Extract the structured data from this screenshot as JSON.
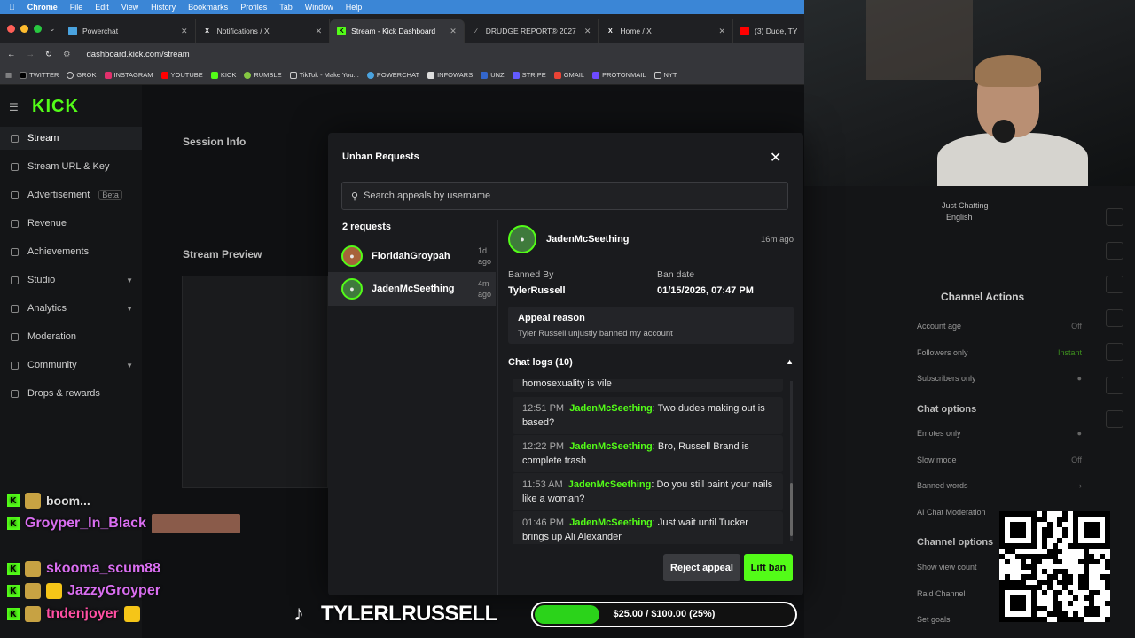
{
  "macbar": {
    "items": [
      "Chrome",
      "File",
      "Edit",
      "View",
      "History",
      "Bookmarks",
      "Profiles",
      "Tab",
      "Window",
      "Help"
    ]
  },
  "tabs": [
    {
      "label": "Powerchat",
      "icon": "powerchat-icon",
      "color": "#4aa3df"
    },
    {
      "label": "Notifications / X",
      "icon": "x-icon",
      "color": "#000000"
    },
    {
      "label": "Stream - Kick Dashboard",
      "icon": "kick-icon",
      "color": "#53fc18",
      "active": true
    },
    {
      "label": "DRUDGE REPORT® 2027",
      "icon": "drudge-icon",
      "color": "#666666"
    },
    {
      "label": "Home / X",
      "icon": "x-icon",
      "color": "#000000"
    },
    {
      "label": "(3) Dude, TY",
      "icon": "youtube-icon",
      "color": "#ff0000"
    }
  ],
  "address": {
    "url": "dashboard.kick.com/stream"
  },
  "bookmarks": [
    {
      "label": "TWITTER",
      "color": "#ffffff"
    },
    {
      "label": "GROK",
      "color": "#ffffff"
    },
    {
      "label": "INSTAGRAM",
      "color": "#e1306c"
    },
    {
      "label": "YOUTUBE",
      "color": "#ff0000"
    },
    {
      "label": "KICK",
      "color": "#53fc18"
    },
    {
      "label": "RUMBLE",
      "color": "#85c742"
    },
    {
      "label": "TikTok - Make You...",
      "color": "#ffffff"
    },
    {
      "label": "POWERCHAT",
      "color": "#4aa3df"
    },
    {
      "label": "INFOWARS",
      "color": "#dddddd"
    },
    {
      "label": "UNZ",
      "color": "#3366cc"
    },
    {
      "label": "STRIPE",
      "color": "#635bff"
    },
    {
      "label": "GMAIL",
      "color": "#ea4335"
    },
    {
      "label": "PROTONMAIL",
      "color": "#6d4aff"
    },
    {
      "label": "NYT",
      "color": "#ffffff"
    }
  ],
  "dashboard": {
    "logo": "KICK",
    "nav": [
      {
        "label": "Stream",
        "active": true
      },
      {
        "label": "Stream URL & Key"
      },
      {
        "label": "Advertisement",
        "badge": "Beta"
      },
      {
        "label": "Revenue"
      },
      {
        "label": "Achievements"
      },
      {
        "label": "Studio",
        "chevron": true
      },
      {
        "label": "Analytics",
        "chevron": true
      },
      {
        "label": "Moderation"
      },
      {
        "label": "Community",
        "chevron": true
      },
      {
        "label": "Drops & rewards"
      }
    ],
    "session_info": "Session Info",
    "stream_preview": "Stream Preview"
  },
  "modal": {
    "title": "Unban Requests",
    "search_placeholder": "Search appeals by username",
    "request_count": "2 requests",
    "requests": [
      {
        "name": "FloridahGroypah",
        "ago": "1d ago"
      },
      {
        "name": "JadenMcSeething",
        "ago": "4m ago",
        "active": true
      }
    ],
    "detail": {
      "name": "JadenMcSeething",
      "ago": "16m ago",
      "banned_by_label": "Banned By",
      "banned_by": "TylerRussell",
      "ban_date_label": "Ban date",
      "ban_date": "01/15/2026, 07:47 PM",
      "appeal_label": "Appeal reason",
      "appeal_text": "Tyler Russell unjustly banned my account",
      "logs_title": "Chat logs (10)",
      "logs_partial": "homosexuality is vile",
      "logs": [
        {
          "time": "12:51 PM",
          "user": "JadenMcSeething",
          "msg": ": Two dudes making out is based?"
        },
        {
          "time": "12:22 PM",
          "user": "JadenMcSeething",
          "msg": ": Bro, Russell Brand is complete trash"
        },
        {
          "time": "11:53 AM",
          "user": "JadenMcSeething",
          "msg": ": Do you still paint your nails like a woman?"
        },
        {
          "time": "01:46 PM",
          "user": "JadenMcSeething",
          "msg": ": Just wait until Tucker brings up Ali Alexander"
        }
      ]
    },
    "reject_label": "Reject appeal",
    "lift_label": "Lift ban"
  },
  "right_panel": {
    "channel_actions": "Channel Actions",
    "rows": [
      {
        "label": "Account age",
        "value": "Off"
      },
      {
        "label": "Followers only",
        "value": "Instant",
        "green": true
      },
      {
        "label": "Subscribers only",
        "value": ""
      }
    ],
    "chat_options": "Chat options",
    "chat_rows": [
      {
        "label": "Emotes only",
        "value": ""
      },
      {
        "label": "Slow mode",
        "value": "Off"
      },
      {
        "label": "Banned words",
        "value": ""
      },
      {
        "label": "AI Chat Moderation",
        "value": ""
      }
    ],
    "channel_options": "Channel options",
    "option_rows": [
      {
        "label": "Show view count",
        "value": ""
      },
      {
        "label": "Raid Channel",
        "value": ""
      },
      {
        "label": "Set goals",
        "value": ""
      }
    ],
    "just_chatting": "Just Chatting",
    "english": "English"
  },
  "overlay": {
    "chat": [
      {
        "name": "Groyper_In_Black",
        "color": "#d96ef0"
      },
      {
        "name": "skooma_scum88",
        "color": "#d96ef0"
      },
      {
        "name": "JazzyGroyper",
        "color": "#d96ef0"
      },
      {
        "name": "tndenjoyer",
        "color": "#ff4fa3"
      }
    ],
    "top_partial": "boom...",
    "brand": "TYLERLRUSSELL",
    "goal_text": "$25.00 / $100.00 (25%)",
    "goal_fraction": 0.25
  }
}
